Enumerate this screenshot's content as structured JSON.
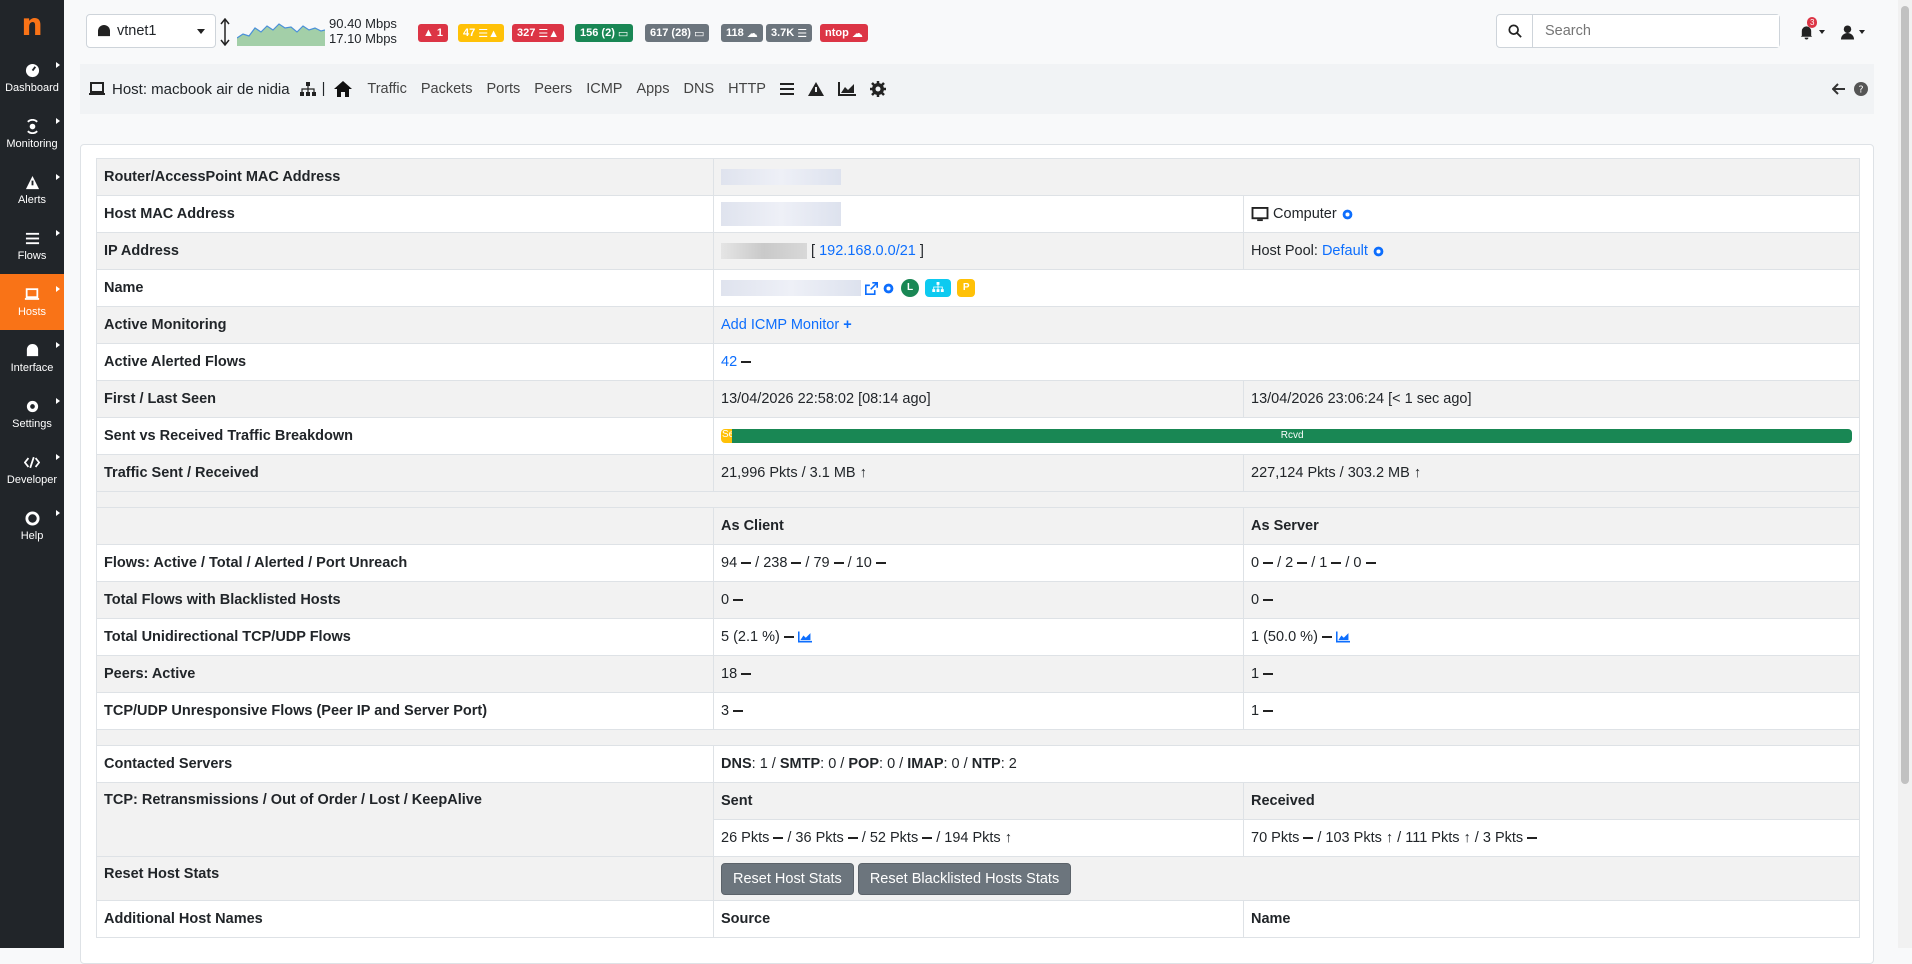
{
  "app": {
    "logo_letter": "n"
  },
  "sidebar": {
    "items": [
      {
        "label": "Dashboard",
        "icon": "dashboard-icon"
      },
      {
        "label": "Monitoring",
        "icon": "monitoring-icon"
      },
      {
        "label": "Alerts",
        "icon": "alerts-icon"
      },
      {
        "label": "Flows",
        "icon": "flows-icon"
      },
      {
        "label": "Hosts",
        "icon": "hosts-icon"
      },
      {
        "label": "Interface",
        "icon": "interface-icon"
      },
      {
        "label": "Settings",
        "icon": "settings-icon"
      },
      {
        "label": "Developer",
        "icon": "developer-icon"
      },
      {
        "label": "Help",
        "icon": "help-icon"
      }
    ]
  },
  "topbar": {
    "interface": "vtnet1",
    "traffic_up": "90.40 Mbps",
    "traffic_down": "17.10 Mbps",
    "badges": [
      {
        "text": "1",
        "color": "#dc3545"
      },
      {
        "text": "47",
        "color": "#ffc107"
      },
      {
        "text": "327",
        "color": "#dc3545"
      },
      {
        "text": "156 (2)",
        "color": "#198754"
      },
      {
        "text": "617 (28)",
        "color": "#6c757d"
      },
      {
        "text": "118",
        "color": "#6c757d"
      },
      {
        "text": "3.7K",
        "color": "#6c757d"
      },
      {
        "text": "ntop",
        "color": "#dc3545"
      }
    ],
    "search_placeholder": "Search",
    "notifications_count": "3"
  },
  "hostbar": {
    "title": "Host: macbook air de nidia",
    "separator": "|",
    "tabs": [
      "Traffic",
      "Packets",
      "Ports",
      "Peers",
      "ICMP",
      "Apps",
      "DNS",
      "HTTP"
    ]
  },
  "rows": {
    "router_mac": {
      "label": "Router/AccessPoint MAC Address"
    },
    "host_mac": {
      "label": "Host MAC Address",
      "device_type": "Computer"
    },
    "ip": {
      "label": "IP Address",
      "bracket_open": "[",
      "network": "192.168.0.0/21",
      "bracket_close": "]",
      "pool_label": "Host Pool:",
      "pool": "Default"
    },
    "name": {
      "label": "Name",
      "badges": [
        {
          "text": "L",
          "color": "#198754"
        },
        {
          "text": "",
          "color": "#0dcaf0"
        },
        {
          "text": "P",
          "color": "#ffc107"
        }
      ]
    },
    "active_monitoring": {
      "label": "Active Monitoring",
      "link": "Add ICMP Monitor"
    },
    "alerted_flows": {
      "label": "Active Alerted Flows",
      "value": "42"
    },
    "first_last_seen": {
      "label": "First / Last Seen",
      "first": "13/04/2026 22:58:02 [08:14 ago]",
      "last": "13/04/2026 23:06:24 [< 1 sec ago]"
    },
    "breakdown": {
      "label": "Sent vs Received Traffic Breakdown",
      "sent_label": "Se",
      "rcvd_label": "Rcvd",
      "sent_fraction": 0.01
    },
    "traffic": {
      "label": "Traffic Sent / Received",
      "sent": "21,996 Pkts / 3.1 MB",
      "received": "227,124 Pkts / 303.2 MB"
    },
    "headers": {
      "client": "As Client",
      "server": "As Server"
    },
    "flows": {
      "label": "Flows: Active / Total / Alerted / Port Unreach",
      "client": [
        "94",
        "238",
        "79",
        "10"
      ],
      "server": [
        "0",
        "2",
        "1",
        "0"
      ]
    },
    "blacklisted": {
      "label": "Total Flows with Blacklisted Hosts",
      "client": "0",
      "server": "0"
    },
    "unidirectional": {
      "label": "Total Unidirectional TCP/UDP Flows",
      "client": "5 (2.1 %)",
      "server": "1 (50.0 %)"
    },
    "peers": {
      "label": "Peers: Active",
      "client": "18",
      "server": "1"
    },
    "unresponsive": {
      "label": "TCP/UDP Unresponsive Flows (Peer IP and Server Port)",
      "client": "3",
      "server": "1"
    },
    "contacted": {
      "label": "Contacted Servers",
      "items": [
        {
          "k": "DNS",
          "v": "1"
        },
        {
          "k": "SMTP",
          "v": "0"
        },
        {
          "k": "POP",
          "v": "0"
        },
        {
          "k": "IMAP",
          "v": "0"
        },
        {
          "k": "NTP",
          "v": "2"
        }
      ]
    },
    "tcp": {
      "label": "TCP: Retransmissions / Out of Order / Lost / KeepAlive",
      "sent_h": "Sent",
      "received_h": "Received",
      "sent": [
        "26 Pkts",
        "36 Pkts",
        "52 Pkts",
        "194 Pkts"
      ],
      "received": [
        "70 Pkts",
        "103 Pkts",
        "111 Pkts",
        "3 Pkts"
      ]
    },
    "reset": {
      "label": "Reset Host Stats",
      "btn1": "Reset Host Stats",
      "btn2": "Reset Blacklisted Hosts Stats"
    },
    "additional": {
      "label": "Additional Host Names",
      "source": "Source",
      "name": "Name"
    }
  }
}
